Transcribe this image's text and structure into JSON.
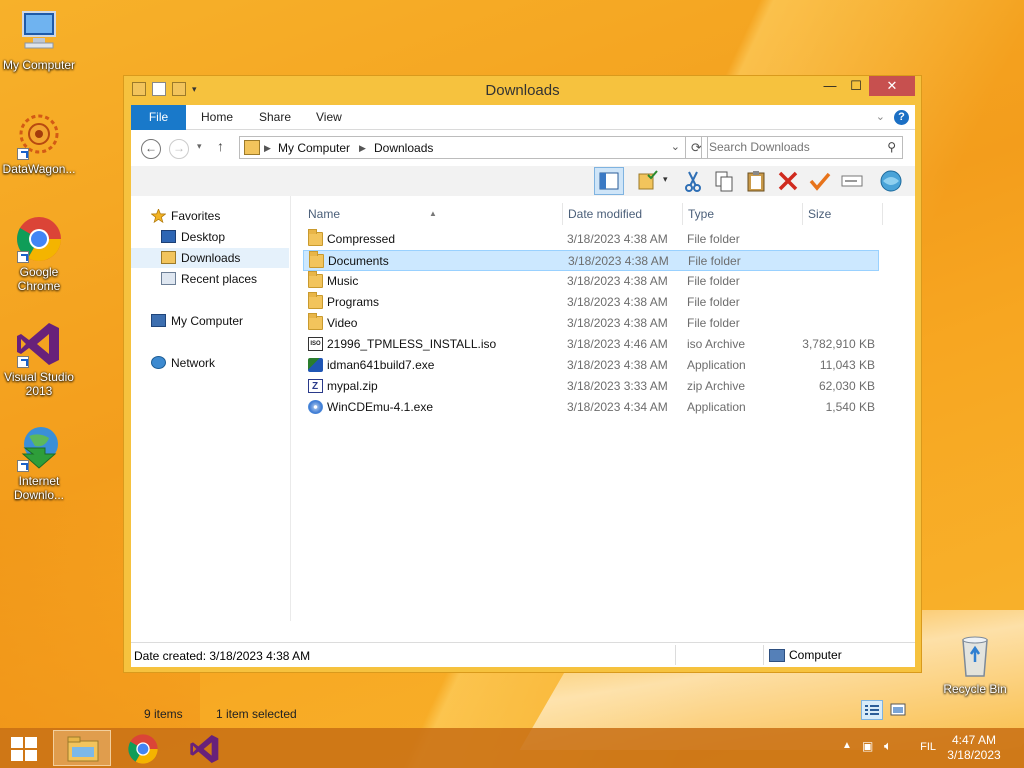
{
  "desktop": {
    "icons": [
      {
        "label": "My Computer"
      },
      {
        "label": "DataWagon..."
      },
      {
        "label": "Google Chrome"
      },
      {
        "label": "Visual Studio 2013"
      },
      {
        "label": "Internet Downlo..."
      },
      {
        "label": "Recycle Bin"
      }
    ]
  },
  "window": {
    "title": "Downloads",
    "controls": {
      "minimize": "—",
      "maximize": "☐",
      "close": "✕"
    },
    "ribbon": {
      "tabs": [
        "File",
        "Home",
        "Share",
        "View"
      ],
      "help": "?"
    },
    "address": {
      "segments": [
        "My Computer",
        "Downloads"
      ],
      "search_placeholder": "Search Downloads"
    },
    "navpane": {
      "favorites": "Favorites",
      "items": [
        "Desktop",
        "Downloads",
        "Recent places"
      ],
      "computer": "My Computer",
      "network": "Network"
    },
    "columns": [
      "Name",
      "Date modified",
      "Type",
      "Size"
    ],
    "files": [
      {
        "name": "Compressed",
        "date": "3/18/2023 4:38 AM",
        "type": "File folder",
        "size": "",
        "icon": "folder-icon"
      },
      {
        "name": "Documents",
        "date": "3/18/2023 4:38 AM",
        "type": "File folder",
        "size": "",
        "icon": "folder-icon"
      },
      {
        "name": "Music",
        "date": "3/18/2023 4:38 AM",
        "type": "File folder",
        "size": "",
        "icon": "folder-icon"
      },
      {
        "name": "Programs",
        "date": "3/18/2023 4:38 AM",
        "type": "File folder",
        "size": "",
        "icon": "folder-icon"
      },
      {
        "name": "Video",
        "date": "3/18/2023 4:38 AM",
        "type": "File folder",
        "size": "",
        "icon": "folder-icon"
      },
      {
        "name": "21996_TPMLESS_INSTALL.iso",
        "date": "3/18/2023 4:46 AM",
        "type": "iso Archive",
        "size": "3,782,910 KB",
        "icon": "iso-file-icon"
      },
      {
        "name": "idman641build7.exe",
        "date": "3/18/2023 4:38 AM",
        "type": "Application",
        "size": "11,043 KB",
        "icon": "exe-icon"
      },
      {
        "name": "mypal.zip",
        "date": "3/18/2023 3:33 AM",
        "type": "zip Archive",
        "size": "62,030 KB",
        "icon": "zip-icon"
      },
      {
        "name": "WinCDEmu-4.1.exe",
        "date": "3/18/2023 4:34 AM",
        "type": "Application",
        "size": "1,540 KB",
        "icon": "cd-exe-icon"
      }
    ],
    "selected_index": 1,
    "status": {
      "items": "9 items",
      "selected": "1 item selected"
    },
    "info": {
      "date_created": "Date created: 3/18/2023 4:38 AM",
      "location": "Computer"
    }
  },
  "taskbar": {
    "language": "FIL",
    "time": "4:47 AM",
    "date": "3/18/2023"
  },
  "colors": {
    "accent": "#1979ca",
    "selection": "#cce8ff",
    "window_frame": "#f6c23e",
    "close_button": "#c7504f"
  }
}
